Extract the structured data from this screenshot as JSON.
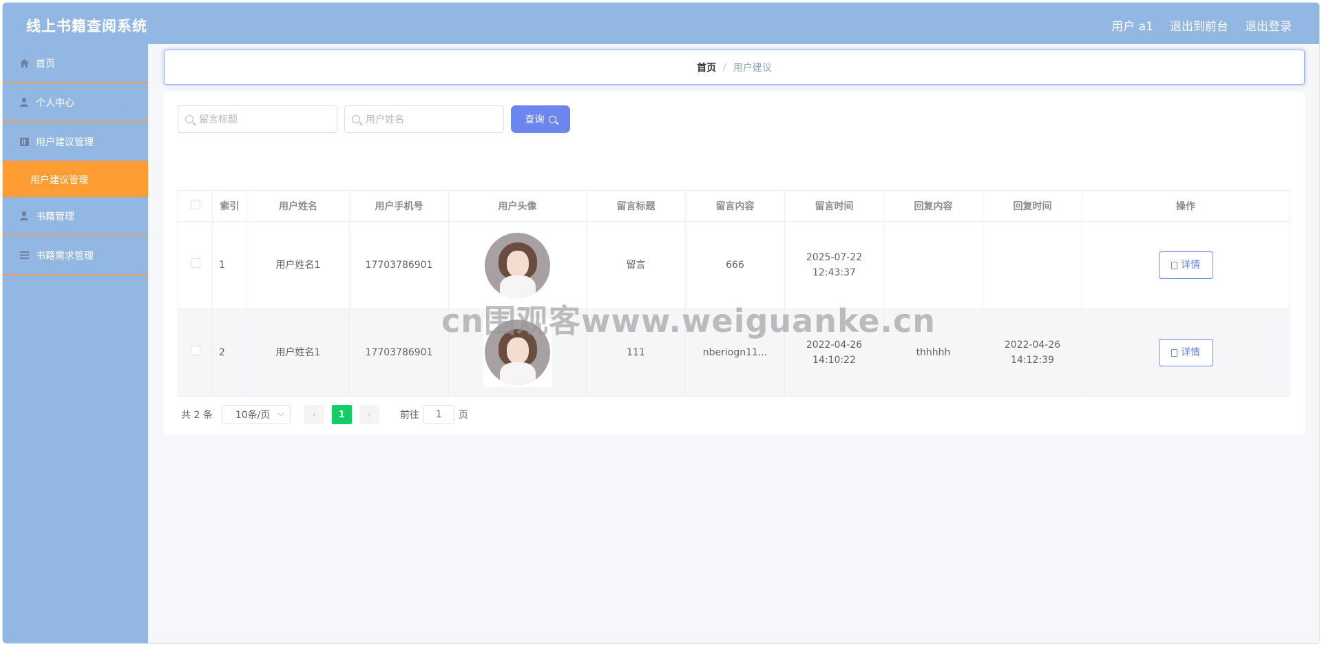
{
  "app": {
    "title": "线上书籍查阅系统"
  },
  "header": {
    "user": "用户 a1",
    "to_front": "退出到前台",
    "logout": "退出登录"
  },
  "sidebar": {
    "items": [
      {
        "label": "首页",
        "icon": "home-icon"
      },
      {
        "label": "个人中心",
        "icon": "user-icon"
      },
      {
        "label": "用户建议管理",
        "icon": "book-icon"
      },
      {
        "label": "书籍管理",
        "icon": "user-icon"
      },
      {
        "label": "书籍需求管理",
        "icon": "list-icon"
      }
    ],
    "sub_active": "用户建议管理"
  },
  "breadcrumb": {
    "home": "首页",
    "separator": "/",
    "current": "用户建议"
  },
  "search": {
    "title_placeholder": "留言标题",
    "name_placeholder": "用户姓名",
    "query_label": "查询"
  },
  "table": {
    "headers": [
      "索引",
      "用户姓名",
      "用户手机号",
      "用户头像",
      "留言标题",
      "留言内容",
      "留言时间",
      "回复内容",
      "回复时间",
      "操作"
    ],
    "rows": [
      {
        "index": "1",
        "name": "用户姓名1",
        "phone": "17703786901",
        "title": "留言",
        "content": "666",
        "time": "2025-07-22 12:43:37",
        "reply": "",
        "reply_time": "",
        "action": "详情"
      },
      {
        "index": "2",
        "name": "用户姓名1",
        "phone": "17703786901",
        "title": "111",
        "content": "nberiogn11...",
        "time": "2022-04-26 14:10:22",
        "reply": "thhhhh",
        "reply_time": "2022-04-26 14:12:39",
        "action": "详情"
      }
    ]
  },
  "pagination": {
    "total": "共 2 条",
    "page_size": "10条/页",
    "prev": "‹",
    "current_page": "1",
    "next": "›",
    "goto_label": "前往",
    "goto_value": "1",
    "page_suffix": "页"
  },
  "watermark": "cn围观客www.weiguanke.cn",
  "colors": {
    "header": "#93b7e3",
    "active_menu": "#ff9d33",
    "primary": "#6c86f0",
    "page_active": "#13ce66"
  }
}
